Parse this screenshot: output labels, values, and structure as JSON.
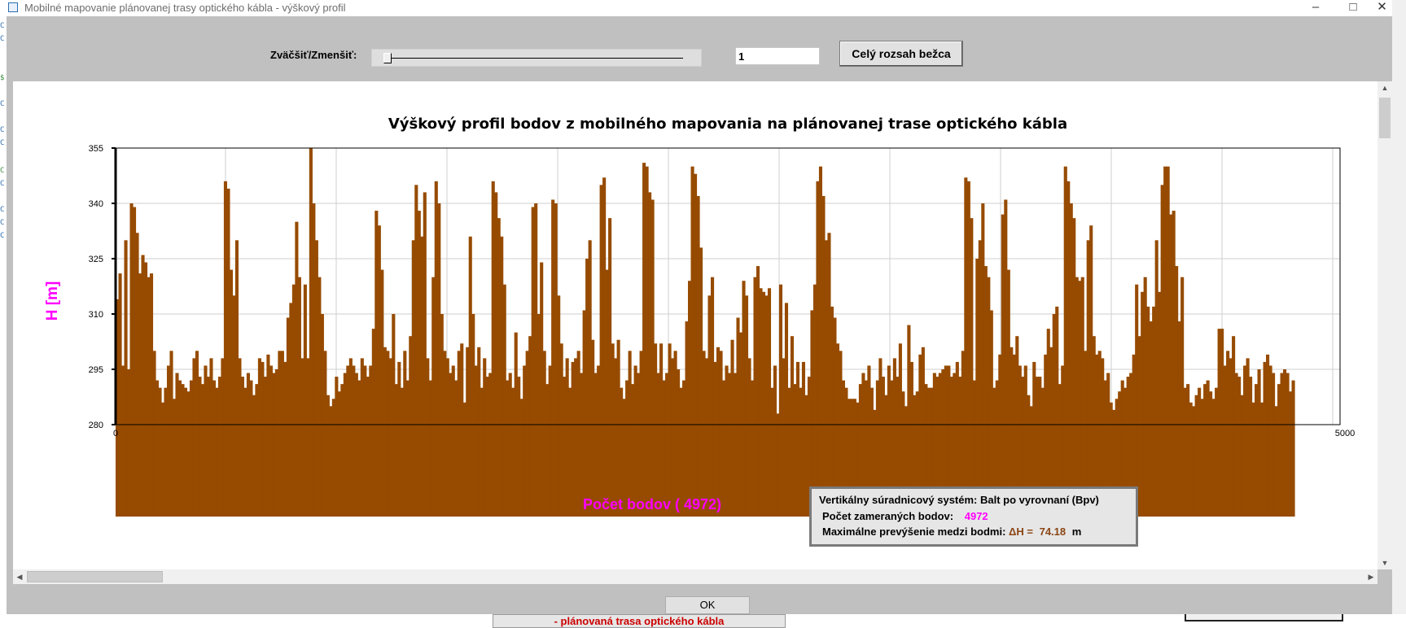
{
  "window": {
    "title": "Mobilné mapovanie plánovanej trasy optického kábla - výškový profil"
  },
  "toolbar": {
    "zoom_label": "Zväčšiť/Zmenšiť:",
    "zoom_value": "1",
    "zoom_slider_level": 0.0,
    "full_range_button": "Celý rozsah bežca"
  },
  "info": {
    "line1": "Vertikálny súradnicový systém: Balt po vyrovnaní (Bpv)",
    "line2_label": "Počet zameraných bodov:",
    "line2_value": "4972",
    "line3_label": "Maximálne prevýšenie medzi bodmi:",
    "line3_delta": "ΔH =",
    "line3_value": "74.18",
    "line3_unit": "m"
  },
  "ok_button": "OK",
  "background_label": "- plánovaná trasa optického kábla",
  "colors": {
    "bar_fill": "#964b00",
    "axis_label": "#ff00ff",
    "info_value": "#ff00ff",
    "delta_text": "#8b4513"
  },
  "chart_data": {
    "type": "area",
    "title": "Výškový profil bodov z mobilného mapovania na plánovanej trase optického kábla",
    "ylabel": "H [m]",
    "xlabel": "Počet bodov ( 4972)",
    "ylim": [
      280,
      355
    ],
    "yticks": [
      "280",
      "295",
      "310",
      "325",
      "340",
      "355"
    ],
    "xlim": [
      0,
      5000
    ],
    "xticks": [
      "0",
      "5000"
    ],
    "grid": true,
    "series": [
      {
        "values": [
          314,
          321,
          296,
          330,
          295,
          340,
          339,
          332,
          321,
          326,
          324,
          320,
          321,
          300,
          292,
          290,
          286,
          290,
          296,
          300,
          287,
          294,
          292,
          291,
          290,
          289,
          292,
          298,
          300,
          293,
          291,
          296,
          293,
          298,
          292,
          290,
          293,
          298,
          346,
          344,
          322,
          315,
          330,
          298,
          293,
          290,
          294,
          292,
          288,
          291,
          298,
          297,
          293,
          299,
          296,
          294,
          295,
          300,
          300,
          297,
          309,
          313,
          318,
          335,
          320,
          298,
          318,
          298,
          355,
          340,
          330,
          320,
          310,
          300,
          288,
          285,
          287,
          293,
          289,
          291,
          294,
          296,
          298,
          296,
          294,
          292,
          298,
          296,
          293,
          296,
          306,
          338,
          334,
          322,
          301,
          300,
          298,
          310,
          291,
          297,
          290,
          300,
          292,
          304,
          330,
          345,
          338,
          331,
          343,
          298,
          292,
          320,
          346,
          340,
          310,
          300,
          298,
          294,
          296,
          292,
          300,
          302,
          286,
          301,
          331,
          310,
          296,
          301,
          290,
          298,
          293,
          294,
          346,
          343,
          336,
          331,
          318,
          292,
          294,
          290,
          305,
          293,
          287,
          296,
          300,
          304,
          339,
          340,
          310,
          324,
          300,
          291,
          296,
          341,
          340,
          315,
          302,
          293,
          298,
          290,
          297,
          298,
          300,
          294,
          311,
          325,
          330,
          303,
          294,
          296,
          345,
          347,
          322,
          336,
          302,
          298,
          303,
          290,
          287,
          292,
          300,
          291,
          296,
          294,
          300,
          351,
          350,
          343,
          341,
          302,
          294,
          302,
          292,
          294,
          302,
          298,
          300,
          295,
          290,
          292,
          308,
          319,
          350,
          348,
          342,
          328,
          300,
          298,
          315,
          320,
          297,
          301,
          300,
          292,
          296,
          294,
          303,
          294,
          309,
          305,
          319,
          315,
          298,
          292,
          320,
          323,
          317,
          316,
          315,
          317,
          290,
          296,
          283,
          318,
          298,
          313,
          290,
          304,
          291,
          297,
          290,
          297,
          288,
          293,
          311,
          318,
          346,
          350,
          342,
          330,
          332,
          312,
          309,
          302,
          300,
          292,
          290,
          287,
          287,
          287,
          286,
          291,
          294,
          292,
          296,
          290,
          284,
          292,
          298,
          293,
          288,
          296,
          292,
          298,
          293,
          302,
          289,
          285,
          307,
          297,
          288,
          289,
          299,
          301,
          291,
          290,
          290,
          294,
          293,
          294,
          295,
          296,
          296,
          293,
          294,
          297,
          293,
          300,
          347,
          346,
          336,
          292,
          325,
          330,
          340,
          323,
          320,
          311,
          290,
          292,
          299,
          337,
          341,
          322,
          301,
          299,
          304,
          296,
          293,
          296,
          288,
          285,
          297,
          293,
          293,
          290,
          299,
          306,
          301,
          310,
          312,
          291,
          296,
          350,
          346,
          340,
          336,
          320,
          319,
          320,
          300,
          330,
          334,
          304,
          299,
          300,
          298,
          292,
          294,
          286,
          284,
          287,
          289,
          292,
          290,
          293,
          294,
          299,
          318,
          304,
          316,
          320,
          312,
          308,
          312,
          330,
          316,
          345,
          350,
          350,
          337,
          338,
          323,
          308,
          320,
          290,
          291,
          286,
          285,
          288,
          290,
          287,
          291,
          292,
          289,
          287,
          290,
          306,
          306,
          296,
          300,
          298,
          304,
          294,
          293,
          288,
          296,
          298,
          293,
          286,
          291,
          295,
          286,
          297,
          299,
          296,
          294,
          285,
          291,
          294,
          295,
          294,
          289,
          292
        ]
      }
    ]
  }
}
